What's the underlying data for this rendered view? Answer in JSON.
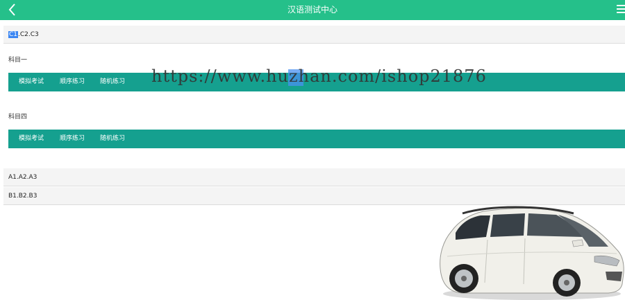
{
  "header": {
    "title": "汉语测试中心",
    "back_icon": "chevron-left-icon",
    "menu_icon": "hamburger-menu-icon",
    "color": "#25c08a"
  },
  "top_selector": {
    "highlighted": "C1",
    "rest": ".C2.C3"
  },
  "subjects": [
    {
      "title": "科目一",
      "buttons": [
        "模拟考试",
        "顺序练习",
        "随机练习"
      ]
    },
    {
      "title": "科目四",
      "buttons": [
        "模拟考试",
        "顺序练习",
        "随机练习"
      ]
    }
  ],
  "bar_color": "#15a08f",
  "license_rows": [
    {
      "label": "A1.A2.A3"
    },
    {
      "label": "B1.B2.B3"
    }
  ],
  "watermark": "https://www.huzhan.com/ishop21876",
  "car_image": "white-minivan-image"
}
